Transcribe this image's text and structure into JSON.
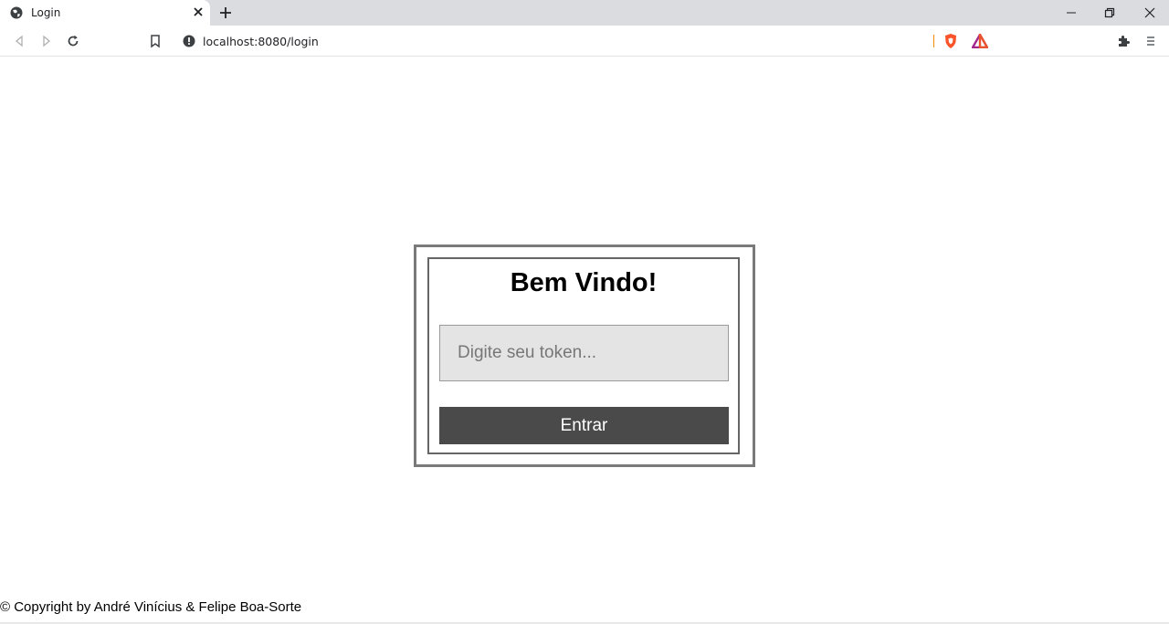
{
  "browser": {
    "tab": {
      "title": "Login",
      "favicon": "globe-icon"
    },
    "address_bar": {
      "url": "localhost:8080/login",
      "security_icon": "info-icon"
    },
    "accent_color": "#f28b00"
  },
  "page": {
    "login": {
      "title": "Bem Vindo!",
      "token_placeholder": "Digite seu token...",
      "token_value": "",
      "submit_label": "Entrar"
    },
    "footer": {
      "text": "© Copyright by André Vinícius & Felipe Boa-Sorte"
    },
    "colors": {
      "button_bg": "#4a4a4a",
      "input_bg": "#e4e4e4",
      "border": "#7a7a7a"
    }
  }
}
